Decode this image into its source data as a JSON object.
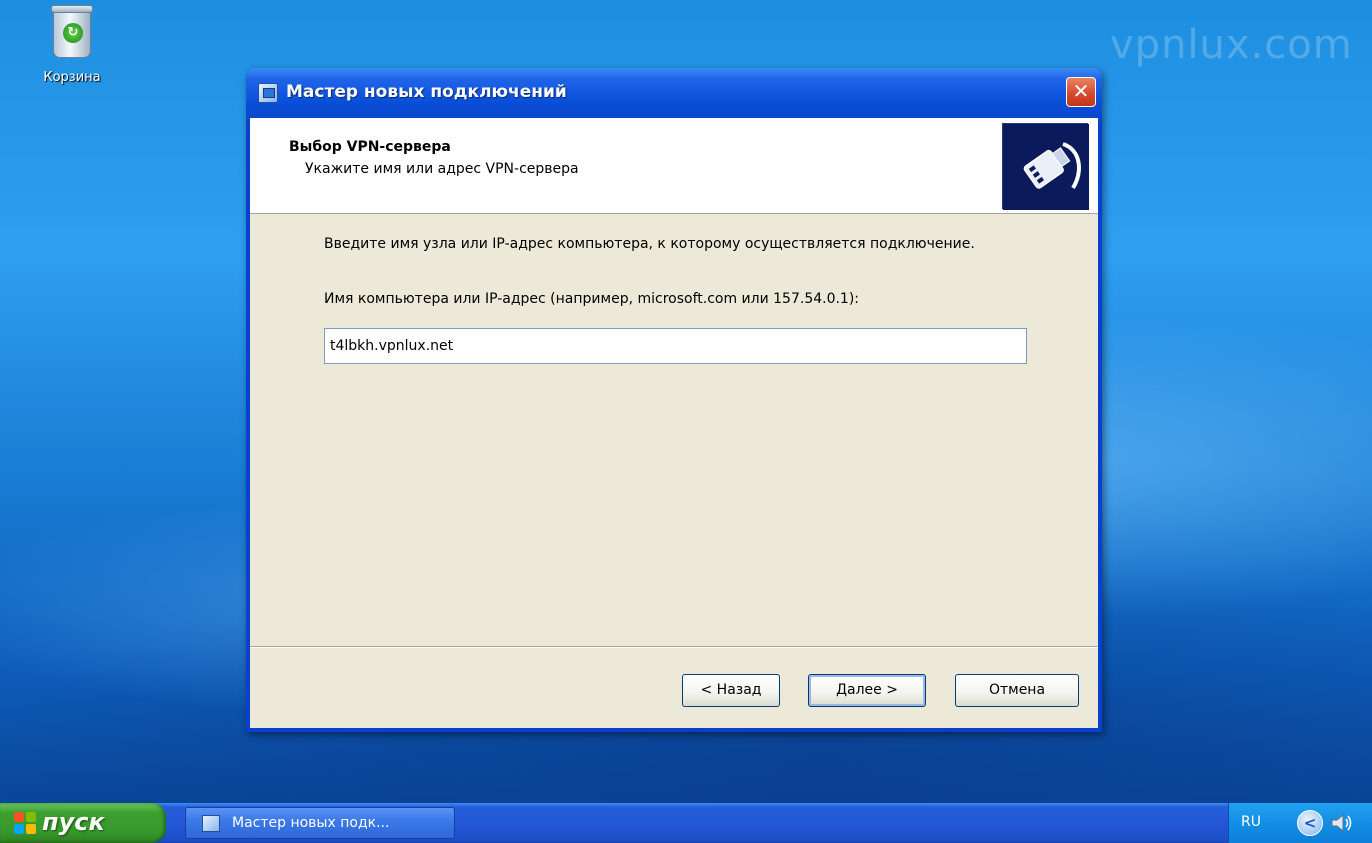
{
  "desktop": {
    "watermark": "vpnlux.com",
    "icons": [
      {
        "label": "Корзина",
        "icon": "recycle-bin-icon"
      }
    ]
  },
  "window": {
    "title": "Мастер новых подключений",
    "close_symbol": "✕",
    "header": {
      "title": "Выбор VPN-сервера",
      "subtitle": "Укажите имя или адрес VPN-сервера",
      "graphic": "network-plug-icon"
    },
    "body": {
      "instruction": "Введите имя узла или IP-адрес компьютера, к  которому осуществляется подключение.",
      "field_label": "Имя компьютера или IP-адрес (например, microsoft.com или 157.54.0.1):",
      "server_value": "t4lbkh.vpnlux.net"
    },
    "buttons": {
      "back": "< Назад",
      "next": "Далее >",
      "cancel": "Отмена"
    }
  },
  "taskbar": {
    "start_label": "пуск",
    "items": [
      {
        "label": "Мастер новых подк...",
        "icon": "wizard-icon"
      }
    ],
    "tray": {
      "language": "RU",
      "expand_symbol": "<",
      "icons": [
        "speaker-icon"
      ]
    }
  },
  "colors": {
    "titlebar": "#0a4fd8",
    "dialog_face": "#ece9d8",
    "start_button": "#3c9f2f",
    "taskbar": "#245edb",
    "close_button": "#d4472a"
  }
}
